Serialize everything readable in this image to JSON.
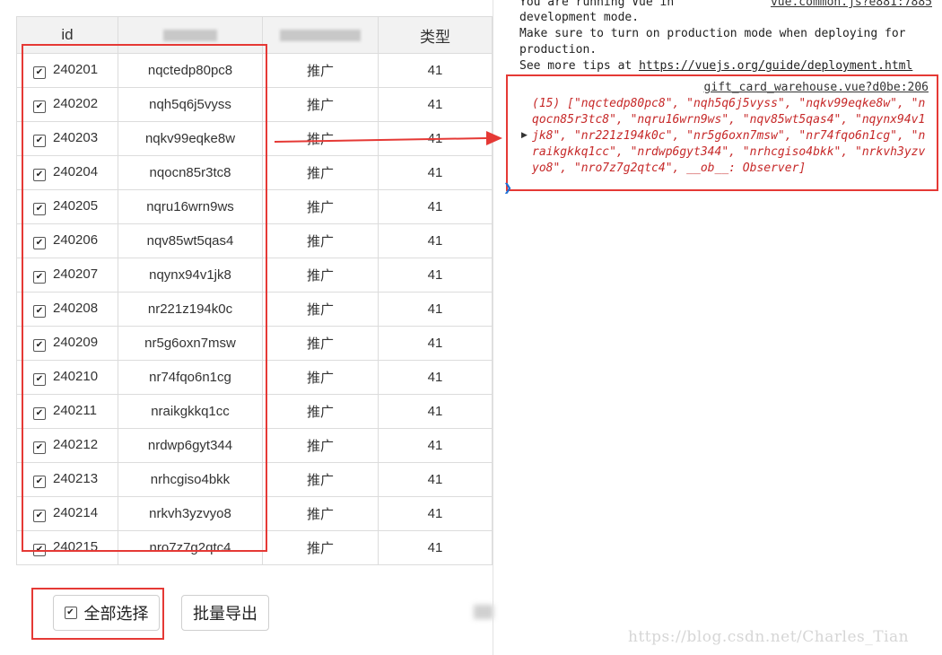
{
  "table": {
    "headers": {
      "id": "id",
      "type": "类型"
    },
    "rows": [
      {
        "id": "240201",
        "code": "nqctedp80pc8",
        "tag": "推广",
        "type": "41"
      },
      {
        "id": "240202",
        "code": "nqh5q6j5vyss",
        "tag": "推广",
        "type": "41"
      },
      {
        "id": "240203",
        "code": "nqkv99eqke8w",
        "tag": "推广",
        "type": "41"
      },
      {
        "id": "240204",
        "code": "nqocn85r3tc8",
        "tag": "推广",
        "type": "41"
      },
      {
        "id": "240205",
        "code": "nqru16wrn9ws",
        "tag": "推广",
        "type": "41"
      },
      {
        "id": "240206",
        "code": "nqv85wt5qas4",
        "tag": "推广",
        "type": "41"
      },
      {
        "id": "240207",
        "code": "nqynx94v1jk8",
        "tag": "推广",
        "type": "41"
      },
      {
        "id": "240208",
        "code": "nr221z194k0c",
        "tag": "推广",
        "type": "41"
      },
      {
        "id": "240209",
        "code": "nr5g6oxn7msw",
        "tag": "推广",
        "type": "41"
      },
      {
        "id": "240210",
        "code": "nr74fqo6n1cg",
        "tag": "推广",
        "type": "41"
      },
      {
        "id": "240211",
        "code": "nraikgkkq1cc",
        "tag": "推广",
        "type": "41"
      },
      {
        "id": "240212",
        "code": "nrdwp6gyt344",
        "tag": "推广",
        "type": "41"
      },
      {
        "id": "240213",
        "code": "nrhcgiso4bkk",
        "tag": "推广",
        "type": "41"
      },
      {
        "id": "240214",
        "code": "nrkvh3yzvyo8",
        "tag": "推广",
        "type": "41"
      },
      {
        "id": "240215",
        "code": "nro7z7g2qtc4",
        "tag": "推广",
        "type": "41"
      }
    ]
  },
  "buttons": {
    "select_all": "全部选择",
    "export": "批量导出"
  },
  "console": {
    "line1": "You are running Vue in",
    "source1": "vue.common.js?e881:7885",
    "line2": "development mode.",
    "line3": "Make sure to turn on production mode when deploying for",
    "line4": "production.",
    "line5_prefix": "See more tips at ",
    "line5_link": "https://vuejs.org/guide/deployment.html",
    "log_source": "gift_card_warehouse.vue?d0be:206",
    "log_text": "(15) [\"nqctedp80pc8\", \"nqh5q6j5vyss\", \"nqkv99eqke8w\", \"nqocn85r3tc8\", \"nqru16wrn9ws\", \"nqv85wt5qas4\", \"nqynx94v1jk8\", \"nr221z194k0c\", \"nr5g6oxn7msw\", \"nr74fqo6n1cg\", \"nraikgkkq1cc\", \"nrdwp6gyt344\", \"nrhcgiso4bkk\", \"nrkvh3yzvyo8\", \"nro7z7g2qtc4\", __ob__: Observer]"
  },
  "watermark": "https://blog.csdn.net/Charles_Tian",
  "colors": {
    "highlight": "#e53935",
    "log_text": "#c62828"
  }
}
